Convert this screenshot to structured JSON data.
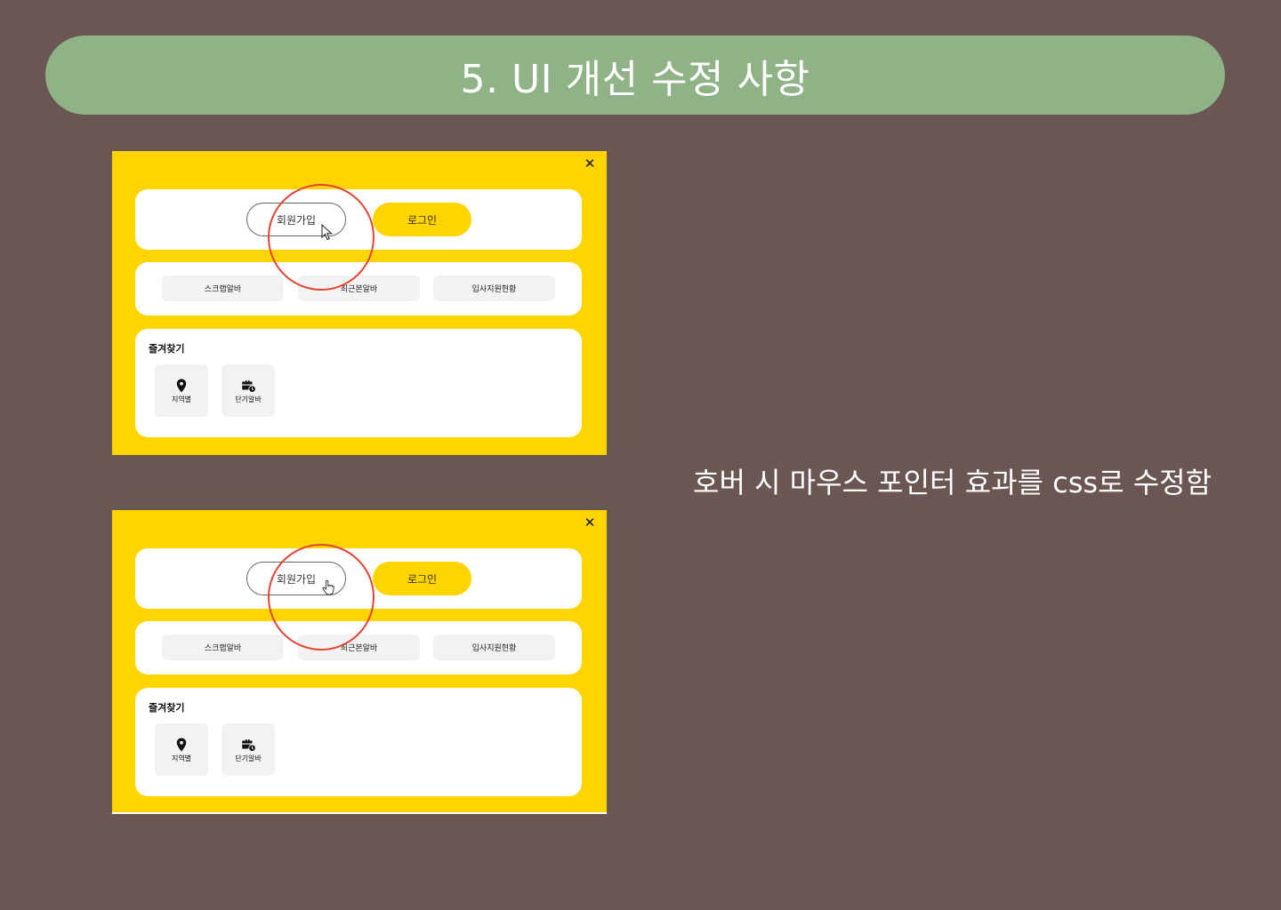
{
  "header": {
    "title": "5. UI 개선 수정 사항"
  },
  "caption": "호버 시 마우스 포인터 효과를 css로 수정함",
  "screens": [
    {
      "cursor": "arrow-cursor",
      "close_label": "✕",
      "auth": {
        "signup": "회원가입",
        "login": "로그인"
      },
      "menu": [
        "스크랩알바",
        "최근본알바",
        "입사지원현황"
      ],
      "favorites": {
        "title": "즐겨찾기",
        "items": [
          {
            "label": "지역별",
            "icon": "location-pin-icon"
          },
          {
            "label": "단기알바",
            "icon": "briefcase-clock-icon"
          }
        ]
      }
    },
    {
      "cursor": "hand-pointer-cursor",
      "close_label": "✕",
      "auth": {
        "signup": "회원가입",
        "login": "로그인"
      },
      "menu": [
        "스크랩알바",
        "최근본알바",
        "입사지원현황"
      ],
      "favorites": {
        "title": "즐겨찾기",
        "items": [
          {
            "label": "지역별",
            "icon": "location-pin-icon"
          },
          {
            "label": "단기알바",
            "icon": "briefcase-clock-icon"
          }
        ]
      }
    }
  ],
  "colors": {
    "background": "#6a5753",
    "header": "#8fb386",
    "accent_yellow": "#ffd400",
    "highlight_circle": "#e24431"
  }
}
